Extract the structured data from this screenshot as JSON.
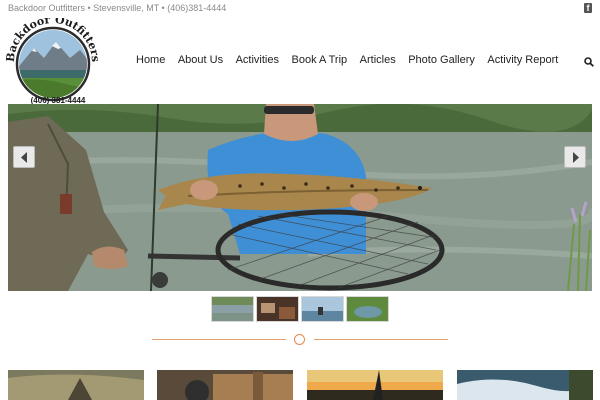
{
  "topbar": {
    "text": "Backdoor Outfitters • Stevensville, MT • (406)381-4444",
    "facebook_icon": "facebook-icon"
  },
  "logo": {
    "arc_text": "Backdoor Outfitters",
    "phone": "(406) 381-4444"
  },
  "nav": {
    "items": [
      {
        "label": "Home"
      },
      {
        "label": "About Us"
      },
      {
        "label": "Activities"
      },
      {
        "label": "Book A Trip"
      },
      {
        "label": "Articles"
      },
      {
        "label": "Photo Gallery"
      },
      {
        "label": "Activity Report"
      }
    ],
    "search_icon": "search-icon"
  },
  "slider": {
    "prev_icon": "chevron-left-icon",
    "next_icon": "chevron-right-icon",
    "thumbnail_count": 4
  },
  "colors": {
    "accent": "#e8894a",
    "nav_text": "#222222",
    "topbar_text": "#8a8a8a"
  }
}
